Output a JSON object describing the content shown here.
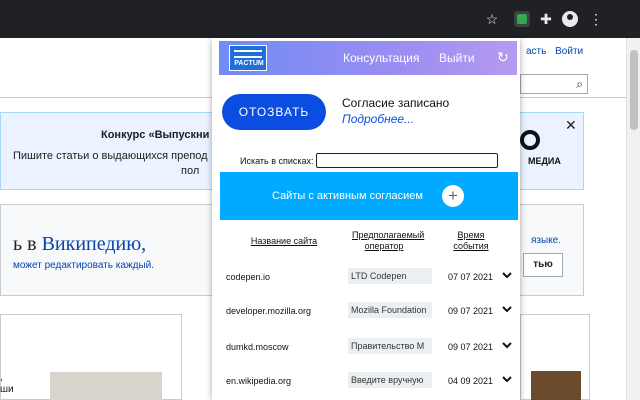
{
  "browser": {
    "icons": [
      "star-icon",
      "pactum-extension-icon",
      "puzzle-icon",
      "avatar",
      "menu-icon"
    ]
  },
  "background_page": {
    "top_links": [
      "асть",
      "Войти"
    ],
    "banner_title": "Конкурс «Выпускни",
    "banner_text": "Пишите статьи о выдающихся препод",
    "banner_text2": "пол",
    "wikimedia_label": "МЕДИА",
    "welcome_prefix": "ь в ",
    "welcome_link": "Википедию,",
    "welcome_sub": "может редактировать каждый.",
    "languages_link": "языке.",
    "button_label": "тью",
    "snippet_lines": [
      ",",
      "ши"
    ]
  },
  "popup": {
    "logo_text": "PACTUM",
    "nav": {
      "consult": "Консультация",
      "logout": "Выйти"
    },
    "revoke_label": "ОТОЗВАТЬ",
    "consent_status": "Согласие записано",
    "consent_more": "Подробнее...",
    "search": {
      "label": "Искать в списках:",
      "value": ""
    },
    "active_section_label": "Сайты с активным согласием",
    "table": {
      "headers": {
        "site": "Название сайта",
        "operator": "Предполагаемый оператор",
        "time": "Время события"
      },
      "rows": [
        {
          "site": "codepen.io",
          "operator": "LTD Codepen",
          "date": "07 07 2021"
        },
        {
          "site": "developer.mozilla.org",
          "operator": "Mozilla Foundation",
          "date": "09 07 2021"
        },
        {
          "site": "dumkd.moscow",
          "operator": "Правительство М",
          "date": "09 07 2021"
        },
        {
          "site": "en.wikipedia.org",
          "operator": "Введите вручную",
          "date": "04 09 2021"
        }
      ]
    }
  },
  "colors": {
    "revoke_button": "#0b4de0",
    "active_bar": "#00aaff",
    "header_gradient_start": "#6f8cf5",
    "header_gradient_end": "#b59af0"
  }
}
